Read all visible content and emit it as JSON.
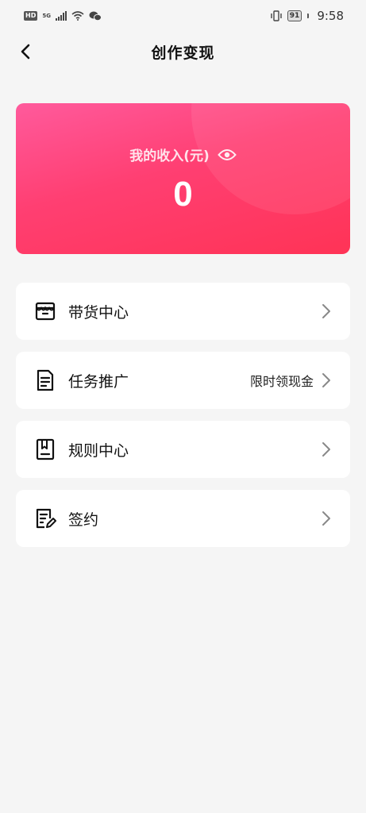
{
  "status_bar": {
    "hd": "HD",
    "network": "5G",
    "battery": "91",
    "time": "9:58"
  },
  "header": {
    "title": "创作变现"
  },
  "income": {
    "label": "我的收入(元)",
    "value": "0"
  },
  "menu": [
    {
      "label": "带货中心",
      "extra": "",
      "icon": "store-icon"
    },
    {
      "label": "任务推广",
      "extra": "限时领现金",
      "icon": "document-icon"
    },
    {
      "label": "规则中心",
      "extra": "",
      "icon": "bookmark-book-icon"
    },
    {
      "label": "签约",
      "extra": "",
      "icon": "contract-edit-icon"
    }
  ],
  "colors": {
    "card_gradient_start": "#ff5a9c",
    "card_gradient_end": "#ff3356",
    "background": "#f5f5f5"
  }
}
